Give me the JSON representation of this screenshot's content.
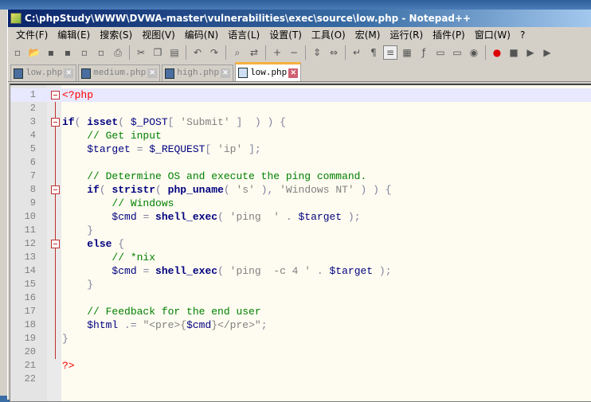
{
  "window": {
    "title": "C:\\phpStudy\\WWW\\DVWA-master\\vulnerabilities\\exec\\source\\low.php - Notepad++"
  },
  "menu": [
    "文件(F)",
    "编辑(E)",
    "搜索(S)",
    "视图(V)",
    "编码(N)",
    "语言(L)",
    "设置(T)",
    "工具(O)",
    "宏(M)",
    "运行(R)",
    "插件(P)",
    "窗口(W)",
    "?"
  ],
  "toolbar": [
    "new",
    "open",
    "save",
    "save-all",
    "close",
    "close-all",
    "print",
    "|",
    "cut",
    "copy",
    "paste",
    "|",
    "undo",
    "redo",
    "|",
    "find",
    "replace",
    "|",
    "zoom-in",
    "zoom-out",
    "|",
    "sync-v",
    "sync-h",
    "|",
    "wrap",
    "all-chars",
    "indent-guide",
    "doc-map",
    "func-list",
    "folder",
    "monitor",
    "eye",
    "|",
    "record",
    "stop",
    "play",
    "run"
  ],
  "tabs": [
    {
      "label": "low.php",
      "selected": false
    },
    {
      "label": "medium.php",
      "selected": false
    },
    {
      "label": "high.php",
      "selected": false
    },
    {
      "label": "low.php",
      "selected": true
    }
  ],
  "code": [
    [
      [
        "p",
        "<?php"
      ]
    ],
    [],
    [
      [
        "k",
        "if"
      ],
      [
        "o",
        "( "
      ],
      [
        "k",
        "isset"
      ],
      [
        "o",
        "( "
      ],
      [
        "v",
        "$_POST"
      ],
      [
        "o",
        "[ "
      ],
      [
        "s",
        "'Submit'"
      ],
      [
        "o",
        " ]  ) ) {"
      ]
    ],
    [
      [
        "",
        "    "
      ],
      [
        "c",
        "// Get input"
      ]
    ],
    [
      [
        "",
        "    "
      ],
      [
        "v",
        "$target"
      ],
      [
        "o",
        " = "
      ],
      [
        "v",
        "$_REQUEST"
      ],
      [
        "o",
        "[ "
      ],
      [
        "s",
        "'ip'"
      ],
      [
        "o",
        " ];"
      ]
    ],
    [],
    [
      [
        "",
        "    "
      ],
      [
        "c",
        "// Determine OS and execute the ping command."
      ]
    ],
    [
      [
        "",
        "    "
      ],
      [
        "k",
        "if"
      ],
      [
        "o",
        "( "
      ],
      [
        "k",
        "stristr"
      ],
      [
        "o",
        "( "
      ],
      [
        "k",
        "php_uname"
      ],
      [
        "o",
        "( "
      ],
      [
        "s",
        "'s'"
      ],
      [
        "o",
        " ), "
      ],
      [
        "s",
        "'Windows NT'"
      ],
      [
        "o",
        " ) ) {"
      ]
    ],
    [
      [
        "",
        "        "
      ],
      [
        "c",
        "// Windows"
      ]
    ],
    [
      [
        "",
        "        "
      ],
      [
        "v",
        "$cmd"
      ],
      [
        "o",
        " = "
      ],
      [
        "k",
        "shell_exec"
      ],
      [
        "o",
        "( "
      ],
      [
        "s",
        "'ping  '"
      ],
      [
        "o",
        " . "
      ],
      [
        "v",
        "$target"
      ],
      [
        "o",
        " );"
      ]
    ],
    [
      [
        "",
        "    "
      ],
      [
        "o",
        "}"
      ]
    ],
    [
      [
        "",
        "    "
      ],
      [
        "k",
        "else"
      ],
      [
        "o",
        " {"
      ]
    ],
    [
      [
        "",
        "        "
      ],
      [
        "c",
        "// *nix"
      ]
    ],
    [
      [
        "",
        "        "
      ],
      [
        "v",
        "$cmd"
      ],
      [
        "o",
        " = "
      ],
      [
        "k",
        "shell_exec"
      ],
      [
        "o",
        "( "
      ],
      [
        "s",
        "'ping  -c 4 '"
      ],
      [
        "o",
        " . "
      ],
      [
        "v",
        "$target"
      ],
      [
        "o",
        " );"
      ]
    ],
    [
      [
        "",
        "    "
      ],
      [
        "o",
        "}"
      ]
    ],
    [],
    [
      [
        "",
        "    "
      ],
      [
        "c",
        "// Feedback for the end user"
      ]
    ],
    [
      [
        "",
        "    "
      ],
      [
        "v",
        "$html"
      ],
      [
        "o",
        " .= "
      ],
      [
        "s",
        "\"<pre>{"
      ],
      [
        "v",
        "$cmd"
      ],
      [
        "s",
        "}</pre>\""
      ],
      [
        "o",
        ";"
      ]
    ],
    [
      [
        "o",
        "}"
      ]
    ],
    [],
    [
      [
        "p",
        "?>"
      ]
    ],
    []
  ],
  "folds": [
    1,
    3,
    8,
    12
  ]
}
